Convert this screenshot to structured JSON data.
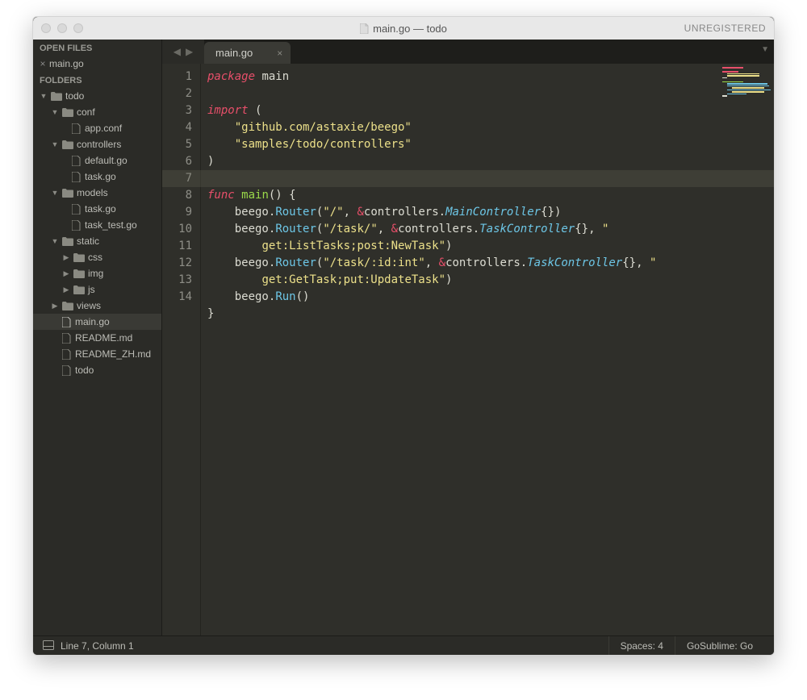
{
  "window": {
    "title": "main.go — todo",
    "unregistered": "UNREGISTERED"
  },
  "sidebar": {
    "open_files_header": "OPEN FILES",
    "open_files": [
      {
        "name": "main.go"
      }
    ],
    "folders_header": "FOLDERS",
    "tree": {
      "root": "todo",
      "conf": {
        "name": "conf",
        "files": [
          "app.conf"
        ]
      },
      "controllers": {
        "name": "controllers",
        "files": [
          "default.go",
          "task.go"
        ]
      },
      "models": {
        "name": "models",
        "files": [
          "task.go",
          "task_test.go"
        ]
      },
      "static": {
        "name": "static",
        "folders": [
          "css",
          "img",
          "js"
        ]
      },
      "views": {
        "name": "views"
      },
      "root_files": [
        "main.go",
        "README.md",
        "README_ZH.md",
        "todo"
      ],
      "active_file": "main.go"
    }
  },
  "tabs": {
    "active": "main.go"
  },
  "editor": {
    "line_numbers": [
      "1",
      "2",
      "3",
      "4",
      "5",
      "6",
      "7",
      "8",
      "9",
      "10",
      "11",
      "",
      "12",
      "",
      "13",
      "14"
    ],
    "highlighted_line": 7,
    "code": {
      "l1": {
        "package_kw": "package",
        "name": "main"
      },
      "l3": {
        "import_kw": "import",
        "paren_open": "("
      },
      "l4": {
        "str": "\"github.com/astaxie/beego\""
      },
      "l5": {
        "str": "\"samples/todo/controllers\""
      },
      "l6": {
        "paren_close": ")"
      },
      "l8": {
        "func_kw": "func",
        "fn": "main",
        "sig": "() {"
      },
      "l9": {
        "recv": "beego",
        "dot": ".",
        "method": "Router",
        "open": "(",
        "s": "\"/\"",
        "comma": ", ",
        "amp": "&",
        "pkg": "controllers",
        "dot2": ".",
        "type": "MainController",
        "braces": "{})"
      },
      "l10": {
        "recv": "beego",
        "dot": ".",
        "method": "Router",
        "open": "(",
        "s": "\"/task/\"",
        "comma": ", ",
        "amp": "&",
        "pkg": "controllers",
        "dot2": ".",
        "type": "TaskController",
        "braces": "{}, ",
        "s2_open": "\"",
        "cont": "get:ListTasks;post:NewTask\"",
        "close": ")"
      },
      "l11": {
        "recv": "beego",
        "dot": ".",
        "method": "Router",
        "open": "(",
        "s": "\"/task/:id:int\"",
        "comma": ", ",
        "amp": "&",
        "pkg": "controllers",
        "dot2": ".",
        "type": "TaskController",
        "braces": "{}, ",
        "s2_open": "\"",
        "cont": "get:GetTask;put:UpdateTask\"",
        "close": ")"
      },
      "l12": {
        "recv": "beego",
        "dot": ".",
        "method": "Run",
        "parens": "()"
      },
      "l13": {
        "brace": "}"
      }
    }
  },
  "statusbar": {
    "position": "Line 7, Column 1",
    "indent": "Spaces: 4",
    "syntax": "GoSublime: Go"
  }
}
